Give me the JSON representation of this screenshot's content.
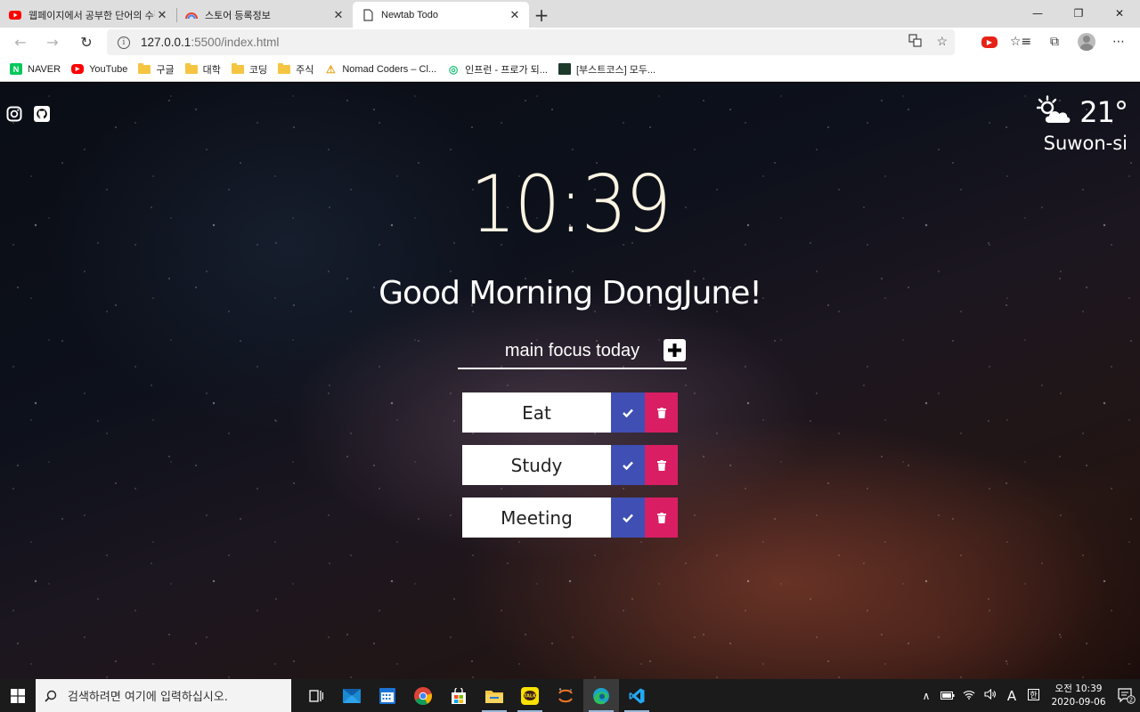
{
  "browser": {
    "tabs": [
      {
        "title": "웹페이지에서 공부한 단어의 수집",
        "icon": "youtube-icon",
        "active": false
      },
      {
        "title": "스토어 등록정보",
        "icon": "rainbow-icon",
        "active": false
      },
      {
        "title": "Newtab Todo",
        "icon": "page-icon",
        "active": true
      }
    ],
    "url_host": "127.0.0.1",
    "url_path": ":5500/index.html",
    "bookmarks": [
      {
        "label": "NAVER",
        "icon": "naver-icon"
      },
      {
        "label": "YouTube",
        "icon": "youtube-icon"
      },
      {
        "label": "구글",
        "icon": "folder-icon"
      },
      {
        "label": "대학",
        "icon": "folder-icon"
      },
      {
        "label": "코딩",
        "icon": "folder-icon"
      },
      {
        "label": "주식",
        "icon": "folder-icon"
      },
      {
        "label": "Nomad Coders – Cl...",
        "icon": "nomad-icon"
      },
      {
        "label": "인프런 - 프로가 되...",
        "icon": "inflearn-icon"
      },
      {
        "label": "[부스트코스] 모두...",
        "icon": "boostcourse-icon"
      }
    ]
  },
  "app": {
    "weather": {
      "temp": "21°",
      "city": "Suwon-si",
      "icon": "partly-cloudy-icon"
    },
    "clock": "10:39",
    "greeting": "Good Morning DongJune!",
    "focus_placeholder": "main focus today",
    "todos": [
      {
        "text": "Eat"
      },
      {
        "text": "Study"
      },
      {
        "text": "Meeting"
      }
    ],
    "colors": {
      "check": "#3f4fb4",
      "delete": "#da1e64",
      "clock": "#fbf4e2"
    }
  },
  "taskbar": {
    "search_placeholder": "검색하려면 여기에 입력하십시오.",
    "ime": "A",
    "time_prefix": "오전 10:39",
    "date": "2020-09-06",
    "notif_count": "2"
  }
}
